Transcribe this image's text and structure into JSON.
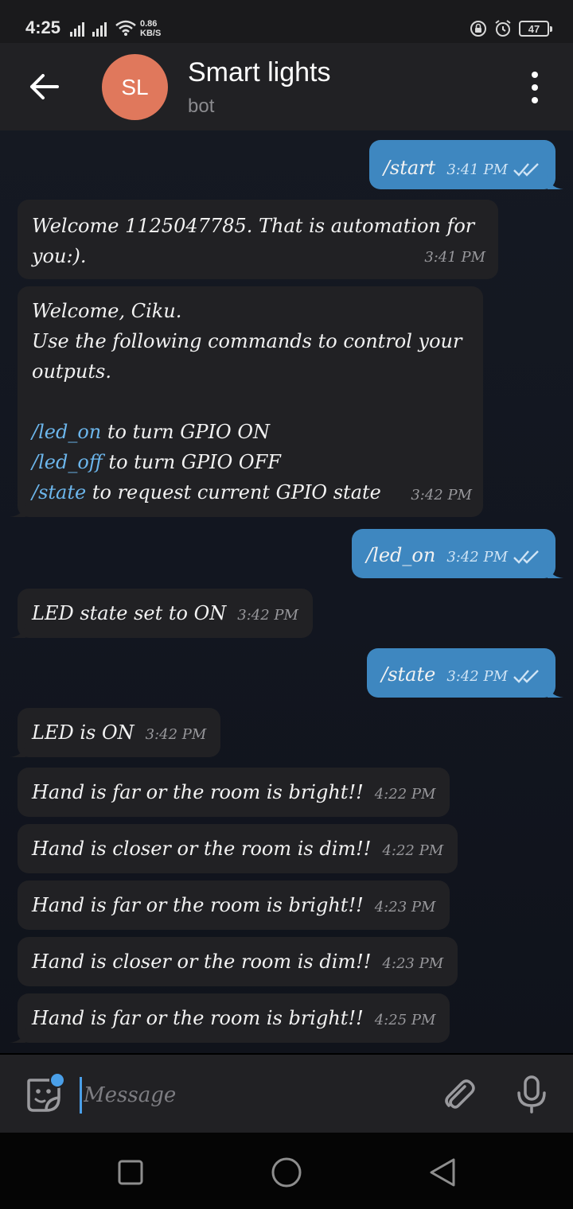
{
  "status_bar": {
    "time": "4:25",
    "net_speed_value": "0.86",
    "net_speed_unit": "KB/S",
    "battery": "47"
  },
  "header": {
    "avatar_initials": "SL",
    "title": "Smart lights",
    "subtitle": "bot"
  },
  "messages": [
    {
      "dir": "out",
      "text": "/start",
      "time": "3:41 PM"
    },
    {
      "dir": "in",
      "text": "Welcome 1125047785. That is automation for you:).",
      "time": "3:41 PM"
    },
    {
      "dir": "in",
      "lines": [
        "Welcome, Ciku.",
        "Use the following commands to control your outputs."
      ],
      "commands": [
        {
          "cmd": "/led_on",
          "desc": "to turn GPIO ON"
        },
        {
          "cmd": "/led_off",
          "desc": "to turn GPIO OFF"
        },
        {
          "cmd": "/state",
          "desc": "to request current GPIO state"
        }
      ],
      "time": "3:42 PM"
    },
    {
      "dir": "out",
      "text": "/led_on",
      "time": "3:42 PM"
    },
    {
      "dir": "in",
      "text": "LED state set to ON",
      "time": "3:42 PM"
    },
    {
      "dir": "out",
      "text": "/state",
      "time": "3:42 PM"
    },
    {
      "dir": "in",
      "text": "LED is ON",
      "time": "3:42 PM"
    },
    {
      "dir": "in",
      "text": "Hand is far or the room is bright!!",
      "time": "4:22 PM"
    },
    {
      "dir": "in",
      "text": "Hand is closer or the room is dim!!",
      "time": "4:22 PM"
    },
    {
      "dir": "in",
      "text": "Hand is far or the room is bright!!",
      "time": "4:23 PM"
    },
    {
      "dir": "in",
      "text": "Hand is closer or the room is dim!!",
      "time": "4:23 PM"
    },
    {
      "dir": "in",
      "text": "Hand is far or the room is bright!!",
      "time": "4:25 PM"
    }
  ],
  "composer": {
    "placeholder": "Message"
  },
  "colors": {
    "outgoing_bubble": "#3e87c0",
    "incoming_bubble": "#212124",
    "command_link": "#6cb6ec",
    "avatar": "#e0785c"
  }
}
